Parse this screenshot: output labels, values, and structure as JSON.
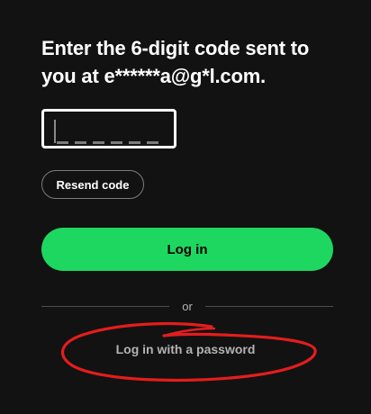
{
  "verification": {
    "heading_line1": "Enter the 6-digit code sent to",
    "heading_line2": "you at e******a@g*l.com.",
    "code_input": {
      "value": "",
      "digits": 6
    }
  },
  "actions": {
    "resend_label": "Resend code",
    "login_label": "Log in",
    "divider_text": "or",
    "password_login_label": "Log in with a password"
  },
  "colors": {
    "background": "#121212",
    "accent": "#1ed760",
    "annotation": "#e31d1d"
  },
  "annotation": {
    "shape": "hand-drawn red ellipse",
    "target": "password_login_label"
  }
}
